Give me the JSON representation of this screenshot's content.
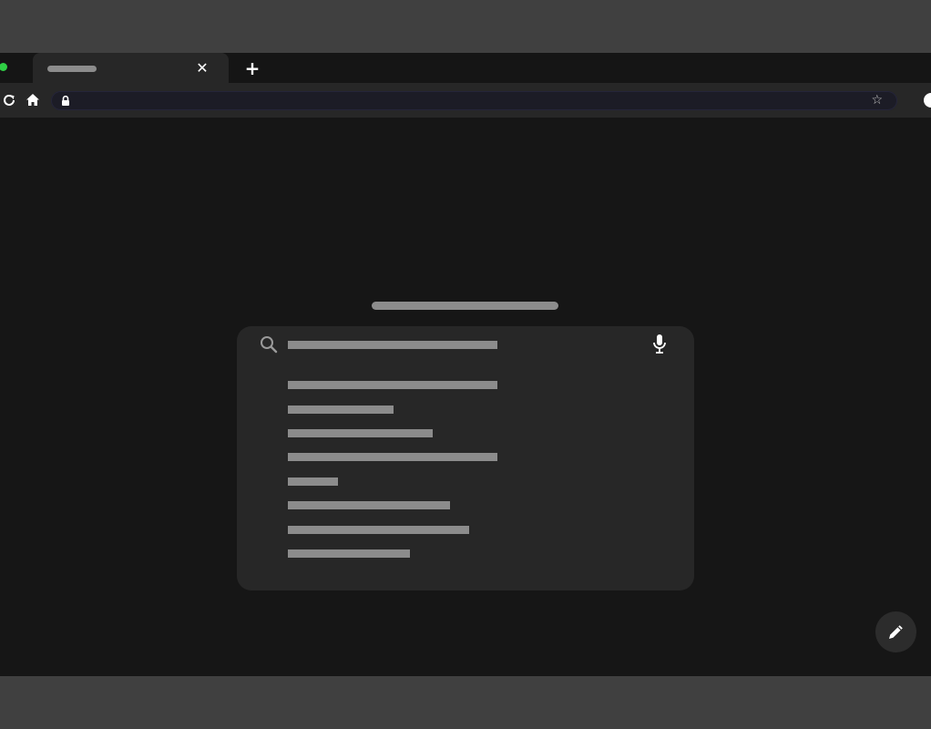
{
  "browser": {
    "tab": {
      "title": "",
      "close_glyph": "✕"
    },
    "new_tab_glyph": "+",
    "omnibox": {
      "url": "",
      "bookmark_glyph": "☆"
    },
    "icons": [
      "reload-icon",
      "home-icon",
      "lock-icon",
      "bookmark-star-icon",
      "profile-icon"
    ],
    "accent_dot_color": "#2fcf45"
  },
  "page": {
    "logo_text": "",
    "search": {
      "query": "",
      "suggestions": [
        "",
        "",
        "",
        "",
        "",
        "",
        "",
        ""
      ]
    },
    "fab_icon": "pencil-icon"
  }
}
